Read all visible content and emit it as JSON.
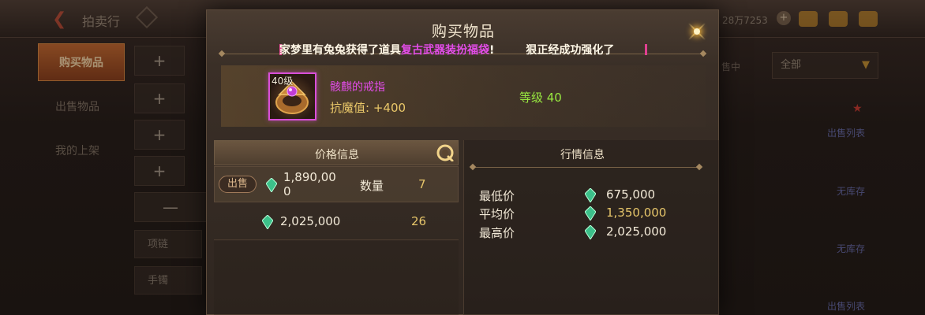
{
  "background": {
    "title": "拍卖行",
    "currency": "28万7253",
    "nav": [
      "购买物品",
      "出售物品",
      "我的上架"
    ],
    "subcategories": [
      "项链",
      "手镯"
    ],
    "right_labels": [
      "售中"
    ],
    "filter_value": "全部",
    "row_links": [
      "出售列表",
      "无库存",
      "无库存",
      "出售列表"
    ]
  },
  "modal": {
    "title": "购买物品",
    "ticker": {
      "part1": "家梦里有兔兔获得了道具",
      "item": "复古武器装扮福袋",
      "part1_end": "!",
      "part2": "狠正经成功强化了"
    },
    "item": {
      "level_badge": "40级",
      "name": "骸麒的戒指",
      "stat_label": "抗魔值:",
      "stat_value": "+400",
      "level_text": "等级 40",
      "rarity_color": "#e24ce8"
    },
    "price_panel": {
      "title": "价格信息",
      "listings": [
        {
          "badge": "出售",
          "price": "1,890,000",
          "qty_label": "数量",
          "qty": "7"
        },
        {
          "price": "2,025,000",
          "qty": "26"
        }
      ]
    },
    "market_panel": {
      "title": "行情信息",
      "rows": [
        {
          "label": "最低价",
          "value": "675,000"
        },
        {
          "label": "平均价",
          "value": "1,350,000"
        },
        {
          "label": "最高价",
          "value": "2,025,000"
        }
      ]
    }
  }
}
